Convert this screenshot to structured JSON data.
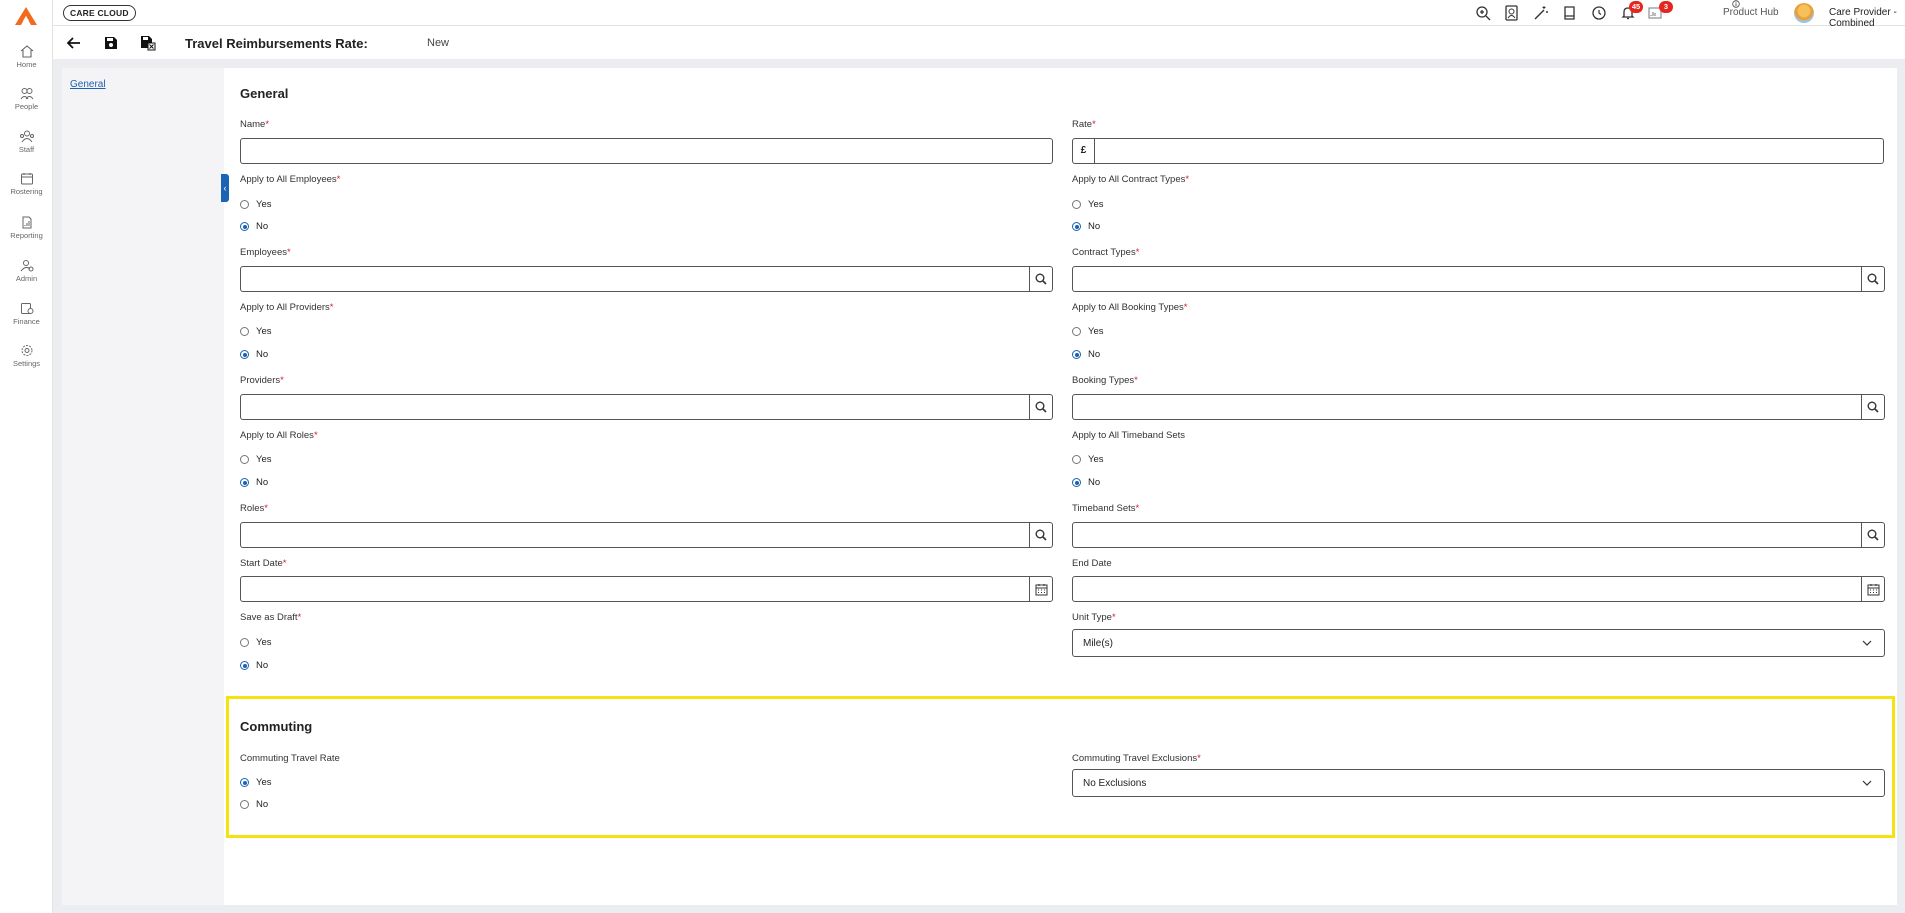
{
  "app": {
    "brand": "CARE CLOUD",
    "notification_count": "45",
    "product_hub_count": "3",
    "product_hub_label": "Product Hub",
    "user_name": "Care Provider - Combined",
    "colors": {
      "accent": "#1a63b5",
      "logo": "#f26b1d",
      "required": "#d0202a",
      "highlight": "#f5e30f",
      "badge": "#e5251f"
    }
  },
  "rail": {
    "items": [
      {
        "label": "Home",
        "icon": "home-icon"
      },
      {
        "label": "People",
        "icon": "people-icon"
      },
      {
        "label": "Staff",
        "icon": "staff-icon"
      },
      {
        "label": "Rostering",
        "icon": "rostering-icon"
      },
      {
        "label": "Reporting",
        "icon": "reporting-icon"
      },
      {
        "label": "Admin",
        "icon": "admin-icon"
      },
      {
        "label": "Finance",
        "icon": "finance-icon"
      },
      {
        "label": "Settings",
        "icon": "settings-icon"
      }
    ]
  },
  "page": {
    "title": "Travel Reimbursements Rate:",
    "status": "New",
    "nav_link": "General"
  },
  "general": {
    "heading": "General",
    "req": "*",
    "name_label": "Name",
    "rate_label": "Rate",
    "currency": "£",
    "all_employees_label": "Apply to All Employees",
    "all_contract_types_label": "Apply to All Contract Types",
    "employees_label": "Employees",
    "contract_types_label": "Contract Types",
    "all_providers_label": "Apply to All Providers",
    "all_booking_types_label": "Apply to All Booking Types",
    "providers_label": "Providers",
    "booking_types_label": "Booking Types",
    "all_roles_label": "Apply to All Roles",
    "all_timeband_sets_label": "Apply to All Timeband Sets",
    "roles_label": "Roles",
    "timeband_sets_label": "Timeband Sets",
    "start_date_label": "Start Date",
    "end_date_label": "End Date",
    "save_draft_label": "Save as Draft",
    "unit_type_label": "Unit Type",
    "unit_type_value": "Mile(s)",
    "yes": "Yes",
    "no": "No"
  },
  "commuting": {
    "heading": "Commuting",
    "rate_label": "Commuting Travel Rate",
    "exclusions_label": "Commuting Travel Exclusions",
    "exclusions_value": "No Exclusions",
    "yes": "Yes",
    "no": "No"
  }
}
